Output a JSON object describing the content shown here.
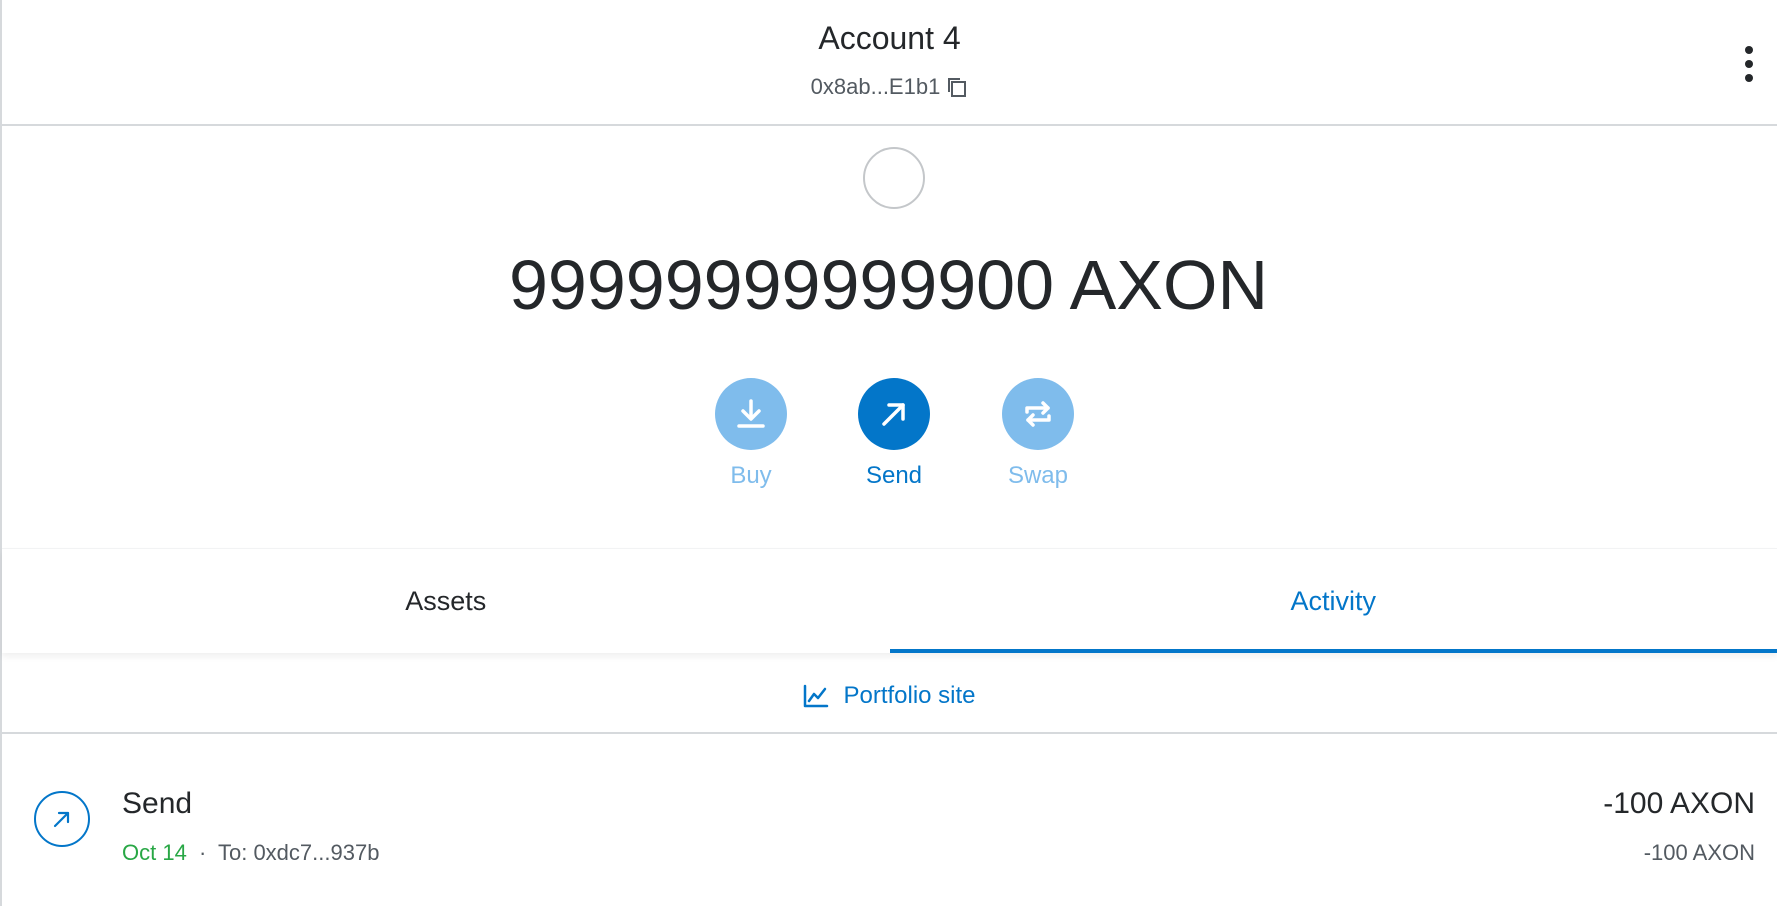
{
  "header": {
    "account_name": "Account 4",
    "address": "0x8ab...E1b1"
  },
  "balance": {
    "amount_text": "99999999999900 AXON"
  },
  "actions": [
    {
      "label": "Buy",
      "icon": "download-icon",
      "state": "disabled"
    },
    {
      "label": "Send",
      "icon": "arrow-up-right-icon",
      "state": "active"
    },
    {
      "label": "Swap",
      "icon": "swap-arrows-icon",
      "state": "disabled"
    }
  ],
  "tabs": [
    {
      "label": "Assets",
      "selected": false
    },
    {
      "label": "Activity",
      "selected": true
    }
  ],
  "portfolio": {
    "label": "Portfolio site",
    "icon": "chart-line-icon"
  },
  "activity": [
    {
      "title": "Send",
      "date": "Oct 14",
      "separator": "·",
      "to": "To: 0xdc7...937b",
      "amount": "-100 AXON",
      "amount_secondary": "-100 AXON",
      "icon": "arrow-up-right-icon"
    }
  ],
  "colors": {
    "primary": "#0376c9",
    "primary_disabled": "#7fbcec",
    "success": "#28a745",
    "text": "#24272a",
    "muted": "#535a61",
    "border": "#d6d9dc"
  }
}
